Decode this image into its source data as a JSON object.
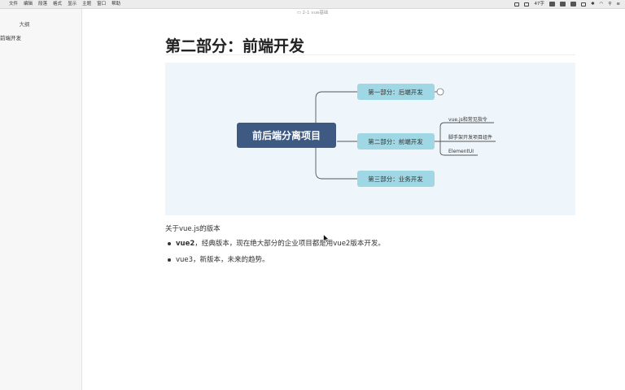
{
  "menubar": {
    "items": [
      "文件",
      "编辑",
      "段落",
      "格式",
      "显示",
      "主题",
      "窗口",
      "帮助"
    ],
    "status_text": "47字"
  },
  "window": {
    "title": "2-1 vue基础"
  },
  "sidebar": {
    "outline_title": "大纲",
    "items": [
      "前端开发"
    ]
  },
  "doc": {
    "heading": "第二部分：前端开发",
    "mindmap": {
      "root": "前后端分离项目",
      "branches": [
        "第一部分：后端开发",
        "第二部分：前端开发",
        "第三部分：业务开发"
      ],
      "leaves": [
        "vue.js和常见指令",
        "脚手架开发项目组件",
        "ElementUI"
      ],
      "colors": {
        "root": "#3f5a82",
        "branch": "#9fd8e4",
        "line": "#555555",
        "background": "#eef6fb"
      }
    },
    "paragraph": "关于vue.js的版本",
    "bullets": [
      {
        "bold": "vue2",
        "text": "，经典版本，现在绝大部分的企业项目都是用vue2版本开发。"
      },
      {
        "bold": "",
        "text": "vue3，新版本，未来的趋势。"
      }
    ]
  }
}
